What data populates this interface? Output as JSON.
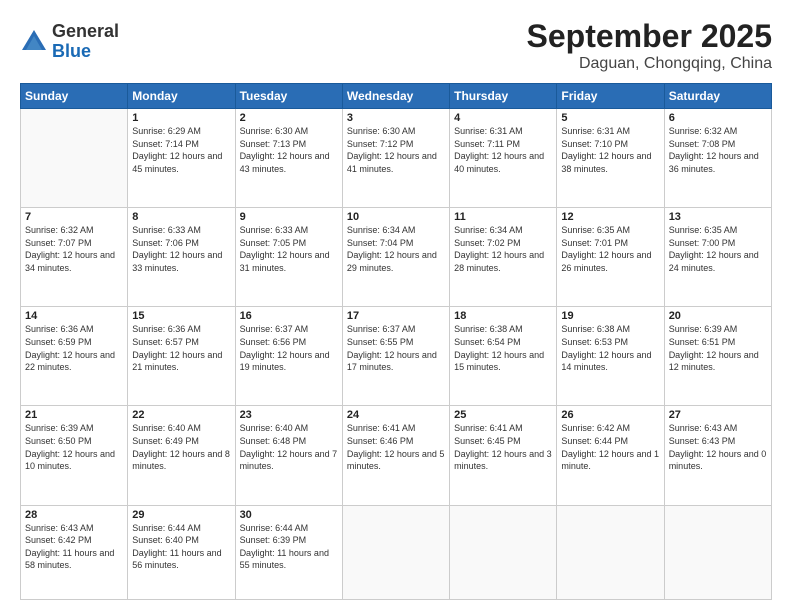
{
  "logo": {
    "general": "General",
    "blue": "Blue"
  },
  "header": {
    "month": "September 2025",
    "location": "Daguan, Chongqing, China"
  },
  "weekdays": [
    "Sunday",
    "Monday",
    "Tuesday",
    "Wednesday",
    "Thursday",
    "Friday",
    "Saturday"
  ],
  "weeks": [
    [
      {
        "day": "",
        "sunrise": "",
        "sunset": "",
        "daylight": ""
      },
      {
        "day": "1",
        "sunrise": "Sunrise: 6:29 AM",
        "sunset": "Sunset: 7:14 PM",
        "daylight": "Daylight: 12 hours and 45 minutes."
      },
      {
        "day": "2",
        "sunrise": "Sunrise: 6:30 AM",
        "sunset": "Sunset: 7:13 PM",
        "daylight": "Daylight: 12 hours and 43 minutes."
      },
      {
        "day": "3",
        "sunrise": "Sunrise: 6:30 AM",
        "sunset": "Sunset: 7:12 PM",
        "daylight": "Daylight: 12 hours and 41 minutes."
      },
      {
        "day": "4",
        "sunrise": "Sunrise: 6:31 AM",
        "sunset": "Sunset: 7:11 PM",
        "daylight": "Daylight: 12 hours and 40 minutes."
      },
      {
        "day": "5",
        "sunrise": "Sunrise: 6:31 AM",
        "sunset": "Sunset: 7:10 PM",
        "daylight": "Daylight: 12 hours and 38 minutes."
      },
      {
        "day": "6",
        "sunrise": "Sunrise: 6:32 AM",
        "sunset": "Sunset: 7:08 PM",
        "daylight": "Daylight: 12 hours and 36 minutes."
      }
    ],
    [
      {
        "day": "7",
        "sunrise": "Sunrise: 6:32 AM",
        "sunset": "Sunset: 7:07 PM",
        "daylight": "Daylight: 12 hours and 34 minutes."
      },
      {
        "day": "8",
        "sunrise": "Sunrise: 6:33 AM",
        "sunset": "Sunset: 7:06 PM",
        "daylight": "Daylight: 12 hours and 33 minutes."
      },
      {
        "day": "9",
        "sunrise": "Sunrise: 6:33 AM",
        "sunset": "Sunset: 7:05 PM",
        "daylight": "Daylight: 12 hours and 31 minutes."
      },
      {
        "day": "10",
        "sunrise": "Sunrise: 6:34 AM",
        "sunset": "Sunset: 7:04 PM",
        "daylight": "Daylight: 12 hours and 29 minutes."
      },
      {
        "day": "11",
        "sunrise": "Sunrise: 6:34 AM",
        "sunset": "Sunset: 7:02 PM",
        "daylight": "Daylight: 12 hours and 28 minutes."
      },
      {
        "day": "12",
        "sunrise": "Sunrise: 6:35 AM",
        "sunset": "Sunset: 7:01 PM",
        "daylight": "Daylight: 12 hours and 26 minutes."
      },
      {
        "day": "13",
        "sunrise": "Sunrise: 6:35 AM",
        "sunset": "Sunset: 7:00 PM",
        "daylight": "Daylight: 12 hours and 24 minutes."
      }
    ],
    [
      {
        "day": "14",
        "sunrise": "Sunrise: 6:36 AM",
        "sunset": "Sunset: 6:59 PM",
        "daylight": "Daylight: 12 hours and 22 minutes."
      },
      {
        "day": "15",
        "sunrise": "Sunrise: 6:36 AM",
        "sunset": "Sunset: 6:57 PM",
        "daylight": "Daylight: 12 hours and 21 minutes."
      },
      {
        "day": "16",
        "sunrise": "Sunrise: 6:37 AM",
        "sunset": "Sunset: 6:56 PM",
        "daylight": "Daylight: 12 hours and 19 minutes."
      },
      {
        "day": "17",
        "sunrise": "Sunrise: 6:37 AM",
        "sunset": "Sunset: 6:55 PM",
        "daylight": "Daylight: 12 hours and 17 minutes."
      },
      {
        "day": "18",
        "sunrise": "Sunrise: 6:38 AM",
        "sunset": "Sunset: 6:54 PM",
        "daylight": "Daylight: 12 hours and 15 minutes."
      },
      {
        "day": "19",
        "sunrise": "Sunrise: 6:38 AM",
        "sunset": "Sunset: 6:53 PM",
        "daylight": "Daylight: 12 hours and 14 minutes."
      },
      {
        "day": "20",
        "sunrise": "Sunrise: 6:39 AM",
        "sunset": "Sunset: 6:51 PM",
        "daylight": "Daylight: 12 hours and 12 minutes."
      }
    ],
    [
      {
        "day": "21",
        "sunrise": "Sunrise: 6:39 AM",
        "sunset": "Sunset: 6:50 PM",
        "daylight": "Daylight: 12 hours and 10 minutes."
      },
      {
        "day": "22",
        "sunrise": "Sunrise: 6:40 AM",
        "sunset": "Sunset: 6:49 PM",
        "daylight": "Daylight: 12 hours and 8 minutes."
      },
      {
        "day": "23",
        "sunrise": "Sunrise: 6:40 AM",
        "sunset": "Sunset: 6:48 PM",
        "daylight": "Daylight: 12 hours and 7 minutes."
      },
      {
        "day": "24",
        "sunrise": "Sunrise: 6:41 AM",
        "sunset": "Sunset: 6:46 PM",
        "daylight": "Daylight: 12 hours and 5 minutes."
      },
      {
        "day": "25",
        "sunrise": "Sunrise: 6:41 AM",
        "sunset": "Sunset: 6:45 PM",
        "daylight": "Daylight: 12 hours and 3 minutes."
      },
      {
        "day": "26",
        "sunrise": "Sunrise: 6:42 AM",
        "sunset": "Sunset: 6:44 PM",
        "daylight": "Daylight: 12 hours and 1 minute."
      },
      {
        "day": "27",
        "sunrise": "Sunrise: 6:43 AM",
        "sunset": "Sunset: 6:43 PM",
        "daylight": "Daylight: 12 hours and 0 minutes."
      }
    ],
    [
      {
        "day": "28",
        "sunrise": "Sunrise: 6:43 AM",
        "sunset": "Sunset: 6:42 PM",
        "daylight": "Daylight: 11 hours and 58 minutes."
      },
      {
        "day": "29",
        "sunrise": "Sunrise: 6:44 AM",
        "sunset": "Sunset: 6:40 PM",
        "daylight": "Daylight: 11 hours and 56 minutes."
      },
      {
        "day": "30",
        "sunrise": "Sunrise: 6:44 AM",
        "sunset": "Sunset: 6:39 PM",
        "daylight": "Daylight: 11 hours and 55 minutes."
      },
      {
        "day": "",
        "sunrise": "",
        "sunset": "",
        "daylight": ""
      },
      {
        "day": "",
        "sunrise": "",
        "sunset": "",
        "daylight": ""
      },
      {
        "day": "",
        "sunrise": "",
        "sunset": "",
        "daylight": ""
      },
      {
        "day": "",
        "sunrise": "",
        "sunset": "",
        "daylight": ""
      }
    ]
  ]
}
